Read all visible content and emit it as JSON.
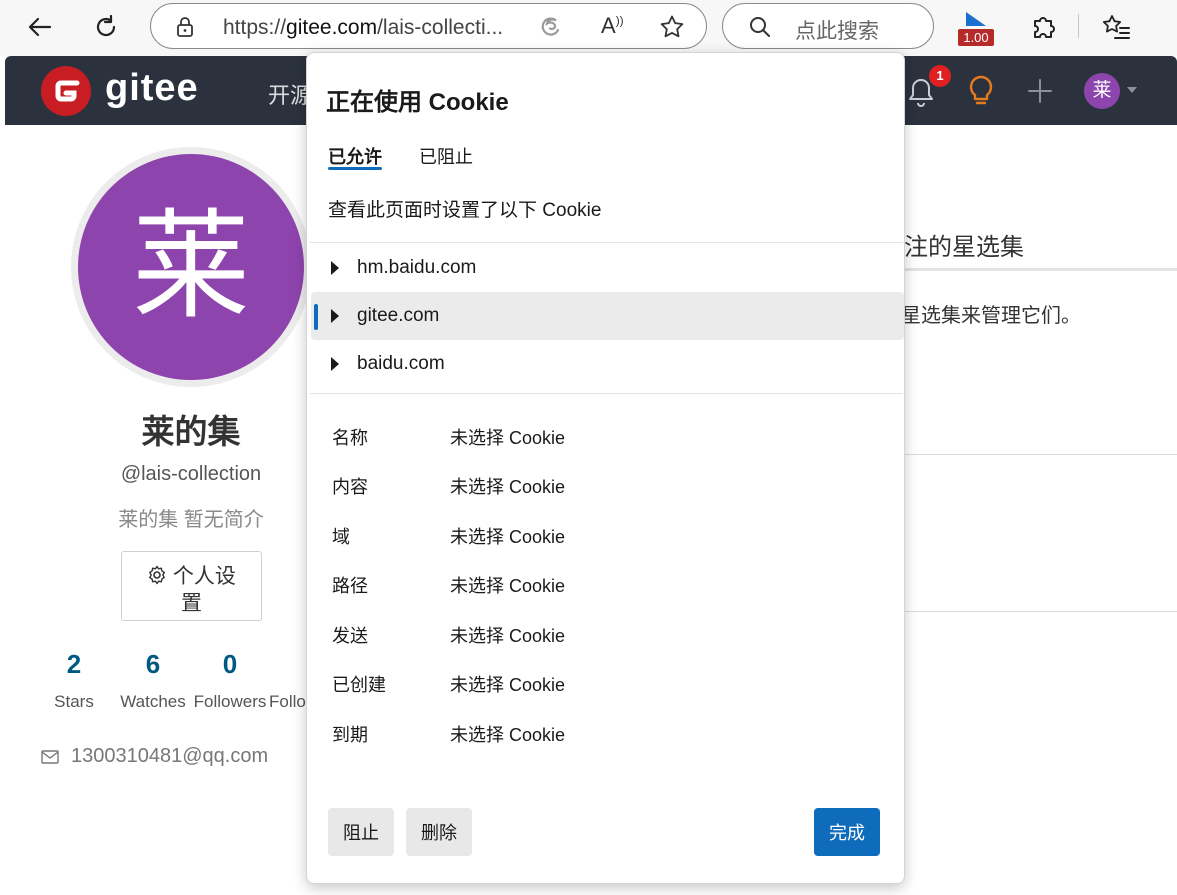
{
  "browser": {
    "url_prefix": "https://",
    "url_host": "gitee.com",
    "url_path": "/lais-collecti...",
    "search_placeholder": "点此搜索",
    "extension_badge": "1.00"
  },
  "gitee": {
    "logo_text": "gitee",
    "nav_open": "开源",
    "notification_count": "1",
    "avatar_char": "莱"
  },
  "profile": {
    "avatar_char": "莱",
    "name": "莱的集",
    "handle": "@lais-collection",
    "bio": "莱的集 暂无简介",
    "settings_line1": "个人设",
    "settings_line2": "置",
    "stats": [
      {
        "num": "2",
        "label": "Stars"
      },
      {
        "num": "6",
        "label": "Watches"
      },
      {
        "num": "0",
        "label": "Followers"
      },
      {
        "num": "",
        "label": "Follo"
      }
    ],
    "email": "1300310481@qq.com"
  },
  "right_panel": {
    "title": "注的星选集",
    "desc": "的星选集来管理它们。"
  },
  "cookie_popup": {
    "title": "正在使用 Cookie",
    "tabs": [
      "已允许",
      "已阻止"
    ],
    "description": "查看此页面时设置了以下 Cookie",
    "domains": [
      "hm.baidu.com",
      "gitee.com",
      "baidu.com"
    ],
    "properties": [
      {
        "key": "名称",
        "value": "未选择 Cookie"
      },
      {
        "key": "内容",
        "value": "未选择 Cookie"
      },
      {
        "key": "域",
        "value": "未选择 Cookie"
      },
      {
        "key": "路径",
        "value": "未选择 Cookie"
      },
      {
        "key": "发送",
        "value": "未选择 Cookie"
      },
      {
        "key": "已创建",
        "value": "未选择 Cookie"
      },
      {
        "key": "到期",
        "value": "未选择 Cookie"
      }
    ],
    "block_label": "阻止",
    "delete_label": "删除",
    "done_label": "完成"
  },
  "colors": {
    "accent": "#0f6cbd",
    "gitee_header": "#2b323d",
    "gitee_red": "#c71d23",
    "avatar_purple": "#8e44ad"
  }
}
